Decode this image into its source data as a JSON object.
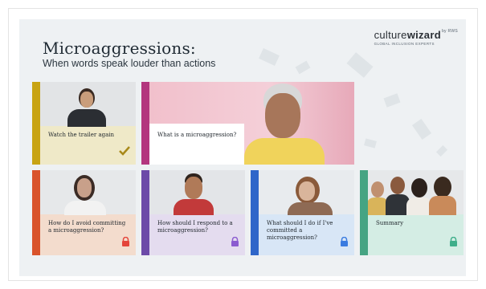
{
  "header": {
    "title": "Microaggressions:",
    "subtitle": "When words speak louder than actions"
  },
  "brand": {
    "name_light": "culture",
    "name_bold": "wizard",
    "by": "by RWS",
    "tagline": "GLOBAL INCLUSION EXPERTS"
  },
  "cards": [
    {
      "label": "Watch the trailer again",
      "status": "check-icon",
      "accent": "#c8a312",
      "bg": "#efe9c8",
      "status_color": "#a8891a"
    },
    {
      "label": "What is a microaggression?",
      "status": "none",
      "accent": "#b3367e",
      "bg": "#f4d3dc"
    },
    {
      "label": "How do I avoid committing a microaggression?",
      "status": "lock-icon",
      "accent": "#d9532b",
      "bg": "#f3dccd",
      "status_color": "#e4443a"
    },
    {
      "label": "How should I respond to a microaggression?",
      "status": "lock-icon",
      "accent": "#6c4aa8",
      "bg": "#e4dcef",
      "status_color": "#8b5bd0"
    },
    {
      "label": "What should I do if I've committed a microaggression?",
      "status": "lock-icon",
      "accent": "#2f66c9",
      "bg": "#d8e6f6",
      "status_color": "#3a7be0"
    },
    {
      "label": "Summary",
      "status": "lock-icon",
      "accent": "#46a483",
      "bg": "#d4ede4",
      "status_color": "#3fae8a"
    }
  ]
}
